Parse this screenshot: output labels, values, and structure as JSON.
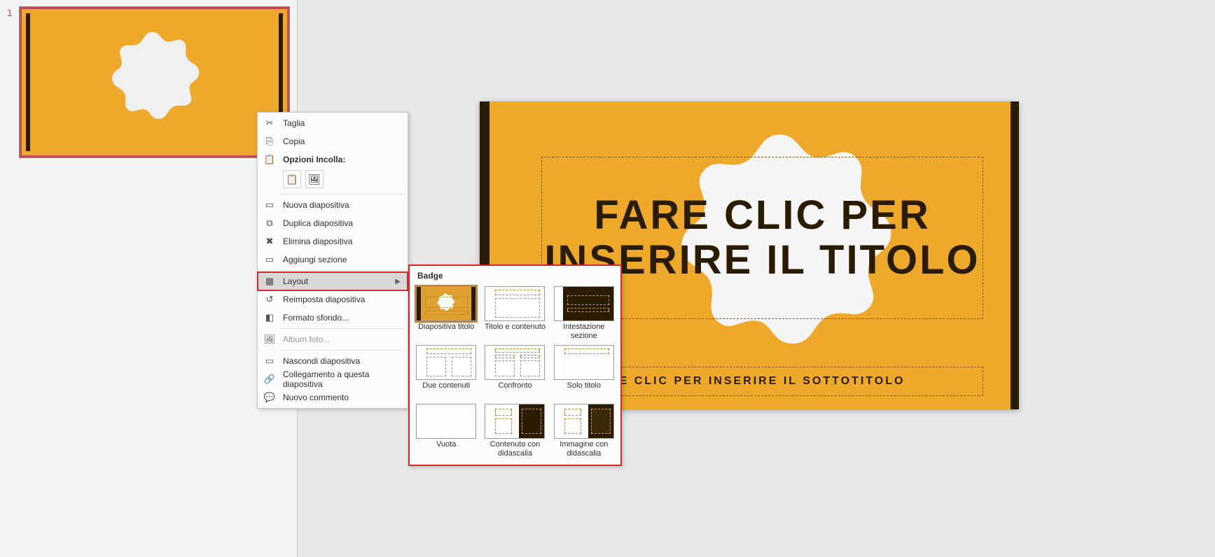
{
  "slide_number": "1",
  "main_slide": {
    "title": "FARE CLIC PER INSERIRE IL TITOLO",
    "subtitle": "E CLIC PER INSERIRE IL SOTTOTITOLO"
  },
  "context_menu": {
    "cut": "Taglia",
    "copy": "Copia",
    "paste_options": "Opzioni Incolla:",
    "new_slide": "Nuova diapositiva",
    "duplicate_slide": "Duplica diapositiva",
    "delete_slide": "Elimina diapositiva",
    "add_section": "Aggiungi sezione",
    "layout": "Layout",
    "reset_slide": "Reimposta diapositiva",
    "format_background": "Formato sfondo...",
    "photo_album": "Album foto...",
    "hide_slide": "Nascondi diapositiva",
    "link_to_slide": "Collegamento a questa diapositiva",
    "new_comment": "Nuovo commento"
  },
  "layout_flyout": {
    "title": "Badge",
    "items": [
      {
        "label": "Diapositiva titolo",
        "selected": true
      },
      {
        "label": "Titolo e contenuto",
        "selected": false
      },
      {
        "label": "Intestazione sezione",
        "selected": false
      },
      {
        "label": "Due contenuti",
        "selected": false
      },
      {
        "label": "Confronto",
        "selected": false
      },
      {
        "label": "Solo titolo",
        "selected": false
      },
      {
        "label": "Vuota",
        "selected": false
      },
      {
        "label": "Contenuto con didascalia",
        "selected": false
      },
      {
        "label": "Immagine con didascalia",
        "selected": false
      }
    ]
  }
}
